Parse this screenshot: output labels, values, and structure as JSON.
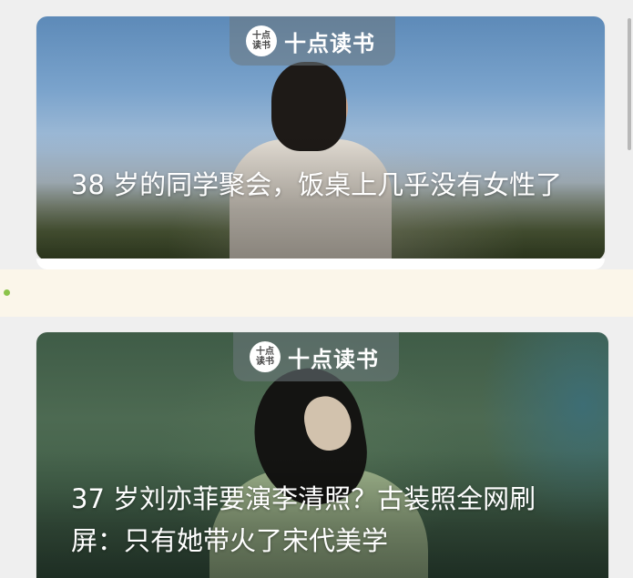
{
  "colors": {
    "page_bg": "#efefef",
    "note_strip_bg": "#fbf6ea",
    "note_dot": "#8bc34a",
    "title_text": "#ffffff"
  },
  "brand": {
    "name": "十点读书",
    "logo_text_line1": "十点",
    "logo_text_line2": "读书"
  },
  "articles": [
    {
      "title": "38 岁的同学聚会，饭桌上几乎没有女性了"
    },
    {
      "title": "37 岁刘亦菲要演李清照？古装照全网刷屏：只有她带火了宋代美学"
    }
  ]
}
